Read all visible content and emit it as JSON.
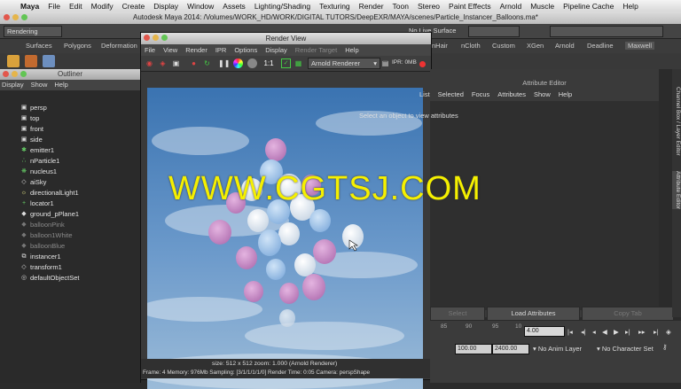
{
  "mac_menu": {
    "apple": "",
    "items": [
      "Maya",
      "File",
      "Edit",
      "Modify",
      "Create",
      "Display",
      "Window",
      "Assets",
      "Lighting/Shading",
      "Texturing",
      "Render",
      "Toon",
      "Stereo",
      "Paint Effects",
      "Arnold",
      "Muscle",
      "Pipeline Cache",
      "Help"
    ]
  },
  "maya_title": "Autodesk Maya 2014: /Volumes/WORK_HD/WORK/DIGITAL TUTORS/DeepEXR/MAYA/scenes/Particle_Instancer_Balloons.ma*",
  "status_row": {
    "menuset": "Rendering",
    "live_surface": "No Live Surface"
  },
  "shelf_tabs": [
    "Surfaces",
    "Polygons",
    "Deformation",
    "nHair",
    "nCloth",
    "Custom",
    "XGen",
    "Arnold",
    "Deadline",
    "Maxwell"
  ],
  "outliner": {
    "title": "Outliner",
    "menu": [
      "Display",
      "Show",
      "Help"
    ],
    "items": [
      {
        "label": "persp",
        "icon": "camera-icon",
        "dim": false
      },
      {
        "label": "top",
        "icon": "camera-icon",
        "dim": false
      },
      {
        "label": "front",
        "icon": "camera-icon",
        "dim": false
      },
      {
        "label": "side",
        "icon": "camera-icon",
        "dim": false
      },
      {
        "label": "emitter1",
        "icon": "emitter-icon",
        "dim": false
      },
      {
        "label": "nParticle1",
        "icon": "particle-icon",
        "dim": false
      },
      {
        "label": "nucleus1",
        "icon": "nucleus-icon",
        "dim": false
      },
      {
        "label": "aiSky",
        "icon": "transform-icon",
        "dim": false
      },
      {
        "label": "directionalLight1",
        "icon": "light-icon",
        "dim": false
      },
      {
        "label": "locator1",
        "icon": "locator-icon",
        "dim": false
      },
      {
        "label": "ground_pPlane1",
        "icon": "mesh-icon",
        "dim": false
      },
      {
        "label": "balloonPink",
        "icon": "mesh-icon",
        "dim": true
      },
      {
        "label": "balloon1White",
        "icon": "mesh-icon",
        "dim": true
      },
      {
        "label": "balloonBlue",
        "icon": "mesh-icon",
        "dim": true
      },
      {
        "label": "instancer1",
        "icon": "instancer-icon",
        "dim": false
      },
      {
        "label": "transform1",
        "icon": "transform-icon",
        "dim": false
      },
      {
        "label": "defaultObjectSet",
        "icon": "set-icon",
        "dim": false
      }
    ]
  },
  "render_view": {
    "title": "Render View",
    "menu": [
      "File",
      "View",
      "Render",
      "IPR",
      "Options",
      "Display",
      "Render Target",
      "Help"
    ],
    "ratio_label": "1:1",
    "renderer": "Arnold Renderer",
    "ipr_label": "IPR: 0MB",
    "status_line1": "size: 512 x 512  zoom: 1.000    (Arnold Renderer)",
    "status_line2": "Frame: 4   Memory: 976Mb   Sampling: [3/1/1/1/1/0]   Render Time: 0:05   Camera: perspShape"
  },
  "attribute_editor": {
    "title": "Attribute Editor",
    "menu": [
      "List",
      "Selected",
      "Focus",
      "Attributes",
      "Show",
      "Help"
    ],
    "message": "Select an object to view attributes",
    "buttons": [
      "Select",
      "Load Attributes",
      "Copy Tab"
    ],
    "side_tabs": [
      "Channel Box / Layer Editor",
      "Attribute Editor"
    ]
  },
  "timeline": {
    "ticks": [
      "85",
      "90",
      "95",
      "10"
    ],
    "current_frame": "4.00",
    "range_end": "100.00",
    "anim_end": "2400.00",
    "anim_layer": "No Anim Layer",
    "character_set": "No Character Set"
  },
  "watermark": "WWW.CGTSJ.COM",
  "colors": {
    "pink_balloon": "#c98ac6",
    "white_balloon": "#e8eef5",
    "blue_balloon": "#a6c8ea",
    "sky_top": "#3f78b4",
    "sky_bottom": "#8fb1d2",
    "watermark": "#f5f000"
  }
}
